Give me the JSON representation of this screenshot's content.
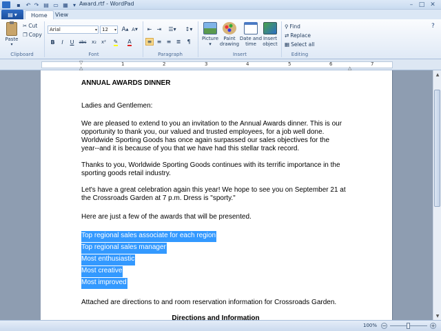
{
  "window": {
    "title": "Award.rtf - WordPad",
    "controls": {
      "minimize": "–",
      "maximize": "□",
      "close": "✕"
    }
  },
  "tabs": [
    {
      "label": "Home",
      "active": true
    },
    {
      "label": "View",
      "active": false
    }
  ],
  "ribbon": {
    "clipboard": {
      "paste": "Paste",
      "cut": "Cut",
      "copy": "Copy",
      "group_label": "Clipboard"
    },
    "font": {
      "family": "Arial",
      "size": "12",
      "group_label": "Font",
      "buttons": {
        "bold": "B",
        "italic": "I",
        "underline": "U",
        "strike": "abc",
        "subscript": "x₂",
        "superscript": "x²",
        "grow": "A",
        "shrink": "A",
        "color": "A"
      }
    },
    "paragraph": {
      "group_label": "Paragraph"
    },
    "insert": {
      "group_label": "Insert",
      "picture": "Picture",
      "paint": "Paint drawing",
      "datetime": "Date and time",
      "object": "Insert object"
    },
    "editing": {
      "group_label": "Editing",
      "find": "Find",
      "replace": "Replace",
      "select_all": "Select all"
    }
  },
  "ruler": {
    "numbers": [
      "1",
      "2",
      "3",
      "4",
      "5",
      "6",
      "7"
    ]
  },
  "document": {
    "heading": "ANNUAL AWARDS DINNER",
    "salutation": "Ladies and Gentlemen:",
    "para1": [
      "We are pleased to extend to you an invitation to the Annual Awards dinner.  This is our",
      "opportunity to thank you, our valued and trusted employees, for a job well done.",
      "Worldwide Sporting Goods has once again surpassed our sales objectives for the",
      "year--and it is because of you that we have had this stellar track record."
    ],
    "para2": [
      "Thanks to you, Worldwide Sporting Goods continues with its terrific importance in the",
      "sporting goods retail industry."
    ],
    "para3": [
      "Let's have a great celebration again this year!  We hope to see you on September 21 at",
      "the Crossroads Garden at 7 p.m. Dress is \"sporty.\""
    ],
    "para4": "Here are just a few of the awards that will be presented.",
    "awards": [
      "Top regional sales associate for each region",
      "Top regional sales manager",
      "Most enthusiastic",
      "Most creative",
      "Most improved"
    ],
    "para5": "Attached are directions to and room reservation information for Crossroads Garden.",
    "subheading": "Directions and Information"
  },
  "status": {
    "zoom": "100%",
    "zoom_fraction": 0.5
  },
  "colors": {
    "accent": "#3399ff",
    "ribbon_bg": "#dfe9f6",
    "doc_bg": "#8e9db1"
  }
}
